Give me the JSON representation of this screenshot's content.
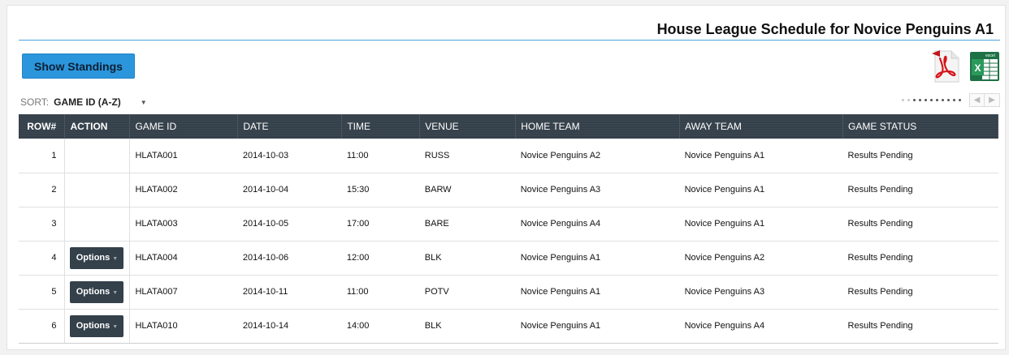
{
  "header": {
    "title": "House League Schedule for Novice Penguins A1"
  },
  "toolbar": {
    "standings_label": "Show Standings",
    "pdf_icon": "pdf-icon",
    "excel_icon": "excel-icon",
    "excel_caption": "excel",
    "excel_letter": "X"
  },
  "sort": {
    "label": "SORT:",
    "value": "GAME ID (A-Z)",
    "caret": "▼"
  },
  "pager": {
    "prev": "◀",
    "next": "▶"
  },
  "table": {
    "columns": [
      "ROW#",
      "ACTION",
      "GAME ID",
      "DATE",
      "TIME",
      "VENUE",
      "HOME TEAM",
      "AWAY TEAM",
      "GAME STATUS"
    ],
    "option_label": "Options",
    "option_caret": "▼",
    "rows": [
      {
        "row": "1",
        "has_options": false,
        "game_id": "HLATA001",
        "date": "2014-10-03",
        "time": "11:00",
        "venue": "RUSS",
        "home": "Novice Penguins A2",
        "away": "Novice Penguins A1",
        "status": "Results Pending"
      },
      {
        "row": "2",
        "has_options": false,
        "game_id": "HLATA002",
        "date": "2014-10-04",
        "time": "15:30",
        "venue": "BARW",
        "home": "Novice Penguins A3",
        "away": "Novice Penguins A1",
        "status": "Results Pending"
      },
      {
        "row": "3",
        "has_options": false,
        "game_id": "HLATA003",
        "date": "2014-10-05",
        "time": "17:00",
        "venue": "BARE",
        "home": "Novice Penguins A4",
        "away": "Novice Penguins A1",
        "status": "Results Pending"
      },
      {
        "row": "4",
        "has_options": true,
        "game_id": "HLATA004",
        "date": "2014-10-06",
        "time": "12:00",
        "venue": "BLK",
        "home": "Novice Penguins A1",
        "away": "Novice Penguins A2",
        "status": "Results Pending"
      },
      {
        "row": "5",
        "has_options": true,
        "game_id": "HLATA007",
        "date": "2014-10-11",
        "time": "11:00",
        "venue": "POTV",
        "home": "Novice Penguins A1",
        "away": "Novice Penguins A3",
        "status": "Results Pending"
      },
      {
        "row": "6",
        "has_options": true,
        "game_id": "HLATA010",
        "date": "2014-10-14",
        "time": "14:00",
        "venue": "BLK",
        "home": "Novice Penguins A1",
        "away": "Novice Penguins A4",
        "status": "Results Pending"
      }
    ]
  },
  "colors": {
    "accent": "#2b96dc",
    "header_bg": "#34404a",
    "rule": "#4aa3df"
  }
}
